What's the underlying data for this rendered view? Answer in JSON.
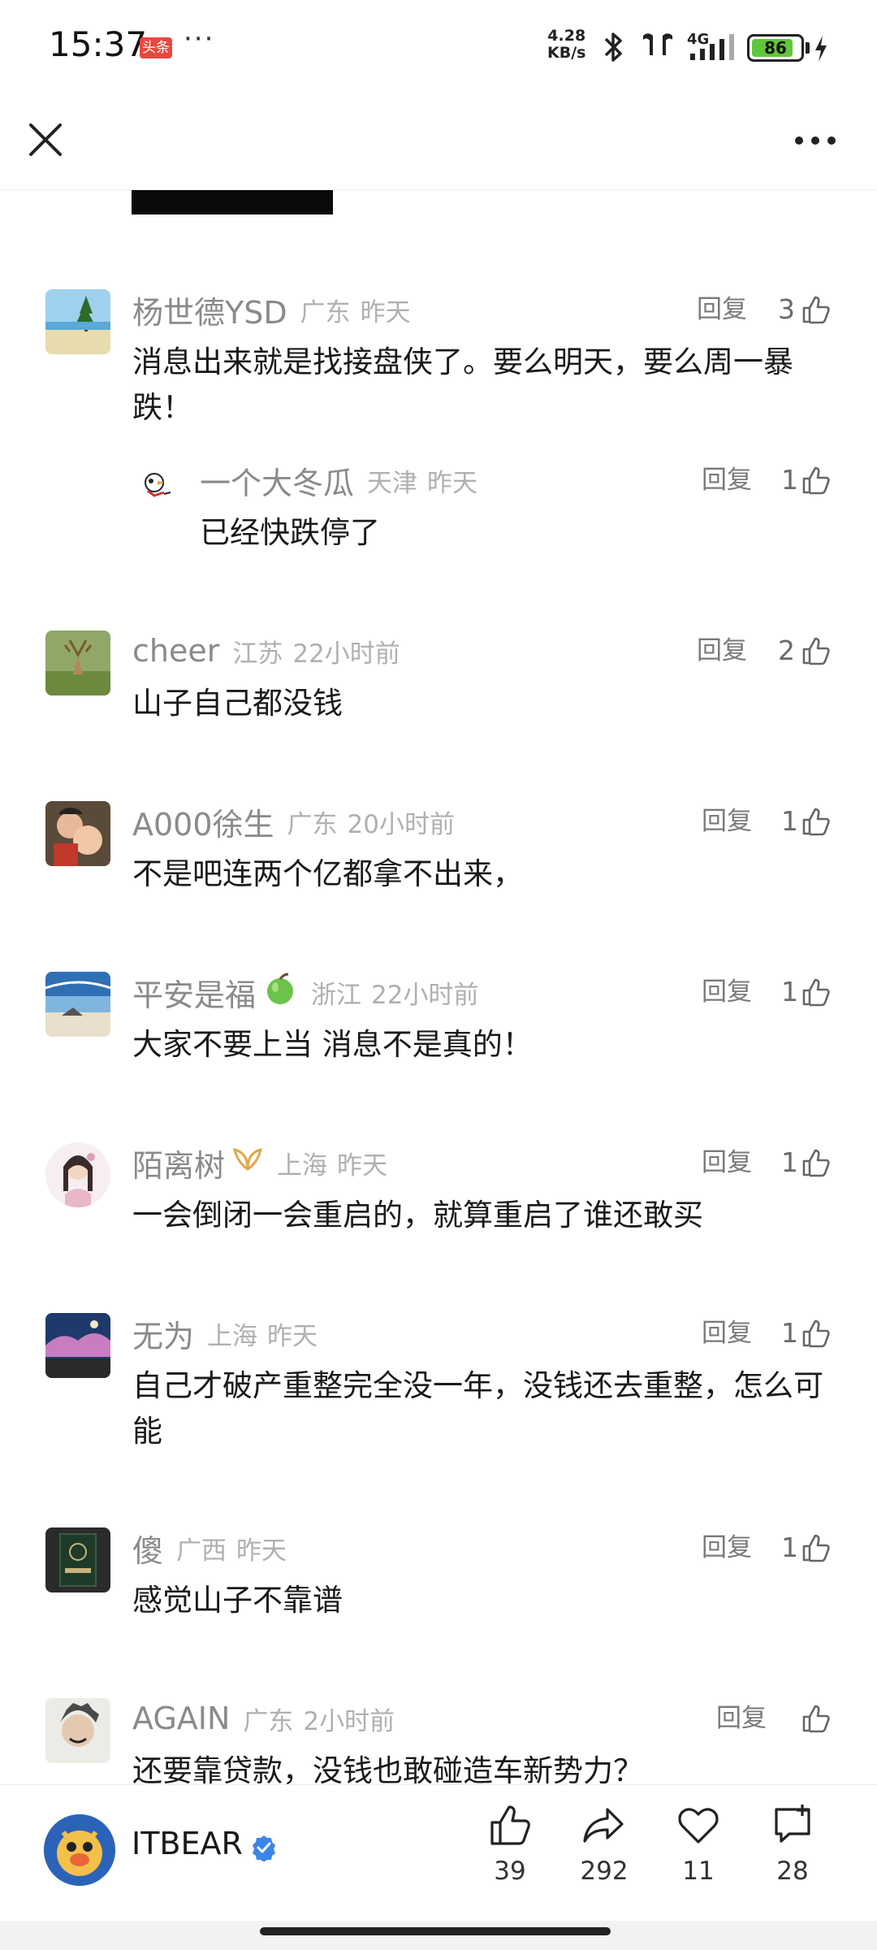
{
  "status_bar": {
    "time": "15:37",
    "app_badge": "头条",
    "more": "···",
    "speed_value": "4.28",
    "speed_unit": "KB/s",
    "network": "4G",
    "battery": "86",
    "battery_level": 0.86,
    "icons": [
      "bluetooth-icon",
      "earbuds-icon",
      "signal-icon",
      "charging-icon"
    ]
  },
  "top_bar": {
    "close_icon": "close-icon",
    "more_icon": "more-icon"
  },
  "comments": [
    {
      "name": "杨世德YSD",
      "location": "广东",
      "time": "昨天",
      "reply_label": "回复",
      "likes": "3",
      "text": "消息出来就是找接盘侠了。要么明天，要么周一暴跌！",
      "replies": [
        {
          "name": "一个大冬瓜",
          "location": "天津",
          "time": "昨天",
          "reply_label": "回复",
          "likes": "1",
          "text": "已经快跌停了"
        }
      ]
    },
    {
      "name": "cheer",
      "location": "江苏",
      "time": "22小时前",
      "reply_label": "回复",
      "likes": "2",
      "text": "山子自己都没钱"
    },
    {
      "name": "A000徐生",
      "location": "广东",
      "time": "20小时前",
      "reply_label": "回复",
      "likes": "1",
      "text": "不是吧连两个亿都拿不出来，"
    },
    {
      "name": "平安是福",
      "location": "浙江",
      "time": "22小时前",
      "reply_label": "回复",
      "likes": "1",
      "text": "大家不要上当 消息不是真的！"
    },
    {
      "name": "陌离树",
      "location": "上海",
      "time": "昨天",
      "reply_label": "回复",
      "likes": "1",
      "text": "一会倒闭一会重启的，就算重启了谁还敢买"
    },
    {
      "name": "无为",
      "location": "上海",
      "time": "昨天",
      "reply_label": "回复",
      "likes": "1",
      "text": "自己才破产重整完全没一年，没钱还去重整，怎么可能"
    },
    {
      "name": "傻",
      "location": "广西",
      "time": "昨天",
      "reply_label": "回复",
      "likes": "1",
      "text": "感觉山子不靠谱"
    },
    {
      "name": "AGAIN",
      "location": "广东",
      "time": "2小时前",
      "reply_label": "回复",
      "likes": "",
      "text": "还要靠贷款，没钱也敢碰造车新势力？"
    }
  ],
  "bottom_bar": {
    "author": "ITBEAR",
    "like_count": "39",
    "share_count": "292",
    "favorite_count": "11",
    "comment_count": "28"
  }
}
